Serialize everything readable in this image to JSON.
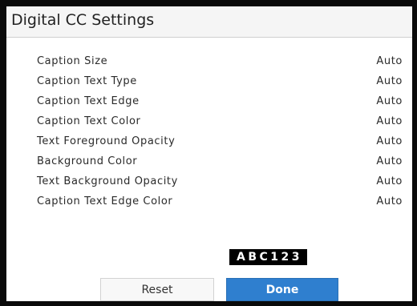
{
  "title": "Digital CC Settings",
  "settings": [
    {
      "label": "Caption Size",
      "value": "Auto"
    },
    {
      "label": "Caption Text Type",
      "value": "Auto"
    },
    {
      "label": "Caption Text Edge",
      "value": "Auto"
    },
    {
      "label": "Caption Text Color",
      "value": "Auto"
    },
    {
      "label": "Text Foreground Opacity",
      "value": "Auto"
    },
    {
      "label": "Background Color",
      "value": "Auto"
    },
    {
      "label": "Text Background Opacity",
      "value": "Auto"
    },
    {
      "label": "Caption Text Edge Color",
      "value": "Auto"
    }
  ],
  "preview_text": "ABC123",
  "buttons": {
    "reset_label": "Reset",
    "done_label": "Done"
  },
  "colors": {
    "accent": "#2f7fcf",
    "preview_background": "#000000",
    "preview_text": "#ffffff"
  }
}
